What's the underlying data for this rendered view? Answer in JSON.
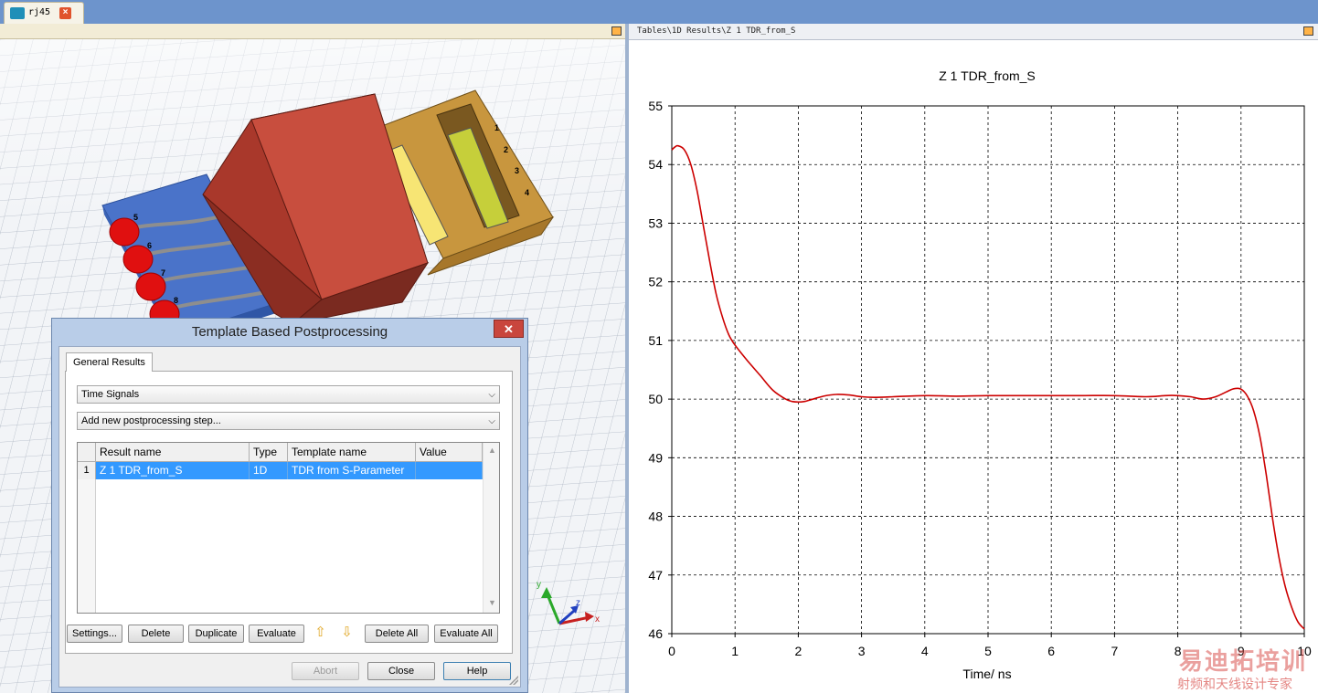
{
  "document_tab": {
    "label": "rj45",
    "close": "×"
  },
  "model": {
    "pin_labels": [
      "1",
      "2",
      "3",
      "4",
      "5",
      "6",
      "7",
      "8"
    ]
  },
  "axes": {
    "x": "x",
    "y": "y",
    "z": "z"
  },
  "chart_header": {
    "path": "Tables\\1D Results\\Z 1 TDR_from_S"
  },
  "chart_data": {
    "type": "line",
    "title": "Z 1 TDR_from_S",
    "xlabel": "Time/ ns",
    "ylabel": "",
    "xlim": [
      0,
      10
    ],
    "ylim": [
      46,
      55
    ],
    "xticks": [
      0,
      1,
      2,
      3,
      4,
      5,
      6,
      7,
      8,
      9,
      10
    ],
    "yticks": [
      46,
      47,
      48,
      49,
      50,
      51,
      52,
      53,
      54,
      55
    ],
    "grid": true,
    "series": [
      {
        "color": "#cc0000",
        "x": [
          0,
          0.05,
          0.1,
          0.2,
          0.3,
          0.4,
          0.5,
          0.6,
          0.7,
          0.8,
          0.9,
          1.0,
          1.2,
          1.4,
          1.6,
          1.8,
          1.9,
          2.0,
          2.1,
          2.2,
          2.4,
          2.6,
          2.8,
          3.0,
          3.2,
          3.5,
          4.0,
          4.5,
          5.0,
          5.5,
          6.0,
          6.5,
          7.0,
          7.5,
          7.8,
          8.0,
          8.2,
          8.4,
          8.6,
          8.8,
          8.9,
          9.0,
          9.1,
          9.2,
          9.3,
          9.4,
          9.5,
          9.6,
          9.7,
          9.8,
          9.9,
          10.0
        ],
        "y": [
          54.25,
          54.3,
          54.32,
          54.25,
          54.0,
          53.55,
          52.95,
          52.35,
          51.8,
          51.4,
          51.1,
          50.92,
          50.65,
          50.4,
          50.15,
          50.0,
          49.96,
          49.95,
          49.96,
          49.99,
          50.05,
          50.08,
          50.07,
          50.04,
          50.03,
          50.04,
          50.06,
          50.05,
          50.06,
          50.06,
          50.06,
          50.06,
          50.06,
          50.04,
          50.06,
          50.06,
          50.04,
          50.0,
          50.04,
          50.14,
          50.18,
          50.17,
          50.05,
          49.8,
          49.35,
          48.7,
          47.95,
          47.3,
          46.8,
          46.45,
          46.2,
          46.08
        ]
      }
    ]
  },
  "dialog": {
    "title": "Template Based Postprocessing",
    "close": "✕",
    "tab": "General Results",
    "combo_category": "Time Signals",
    "combo_step": "Add new postprocessing step...",
    "columns": [
      "Result name",
      "Type",
      "Template name",
      "Value"
    ],
    "rows": [
      {
        "num": "1",
        "result_name": "Z 1 TDR_from_S",
        "type": "1D",
        "template": "TDR from S-Parameter",
        "value": ""
      }
    ],
    "buttons": {
      "settings": "Settings...",
      "delete": "Delete",
      "duplicate": "Duplicate",
      "evaluate": "Evaluate",
      "move_up": "⇧",
      "move_down": "⇩",
      "delete_all": "Delete All",
      "evaluate_all": "Evaluate All",
      "abort": "Abort",
      "close": "Close",
      "help": "Help"
    }
  },
  "watermark": {
    "line1": "易迪拓培训",
    "line2": "射频和天线设计专家"
  }
}
